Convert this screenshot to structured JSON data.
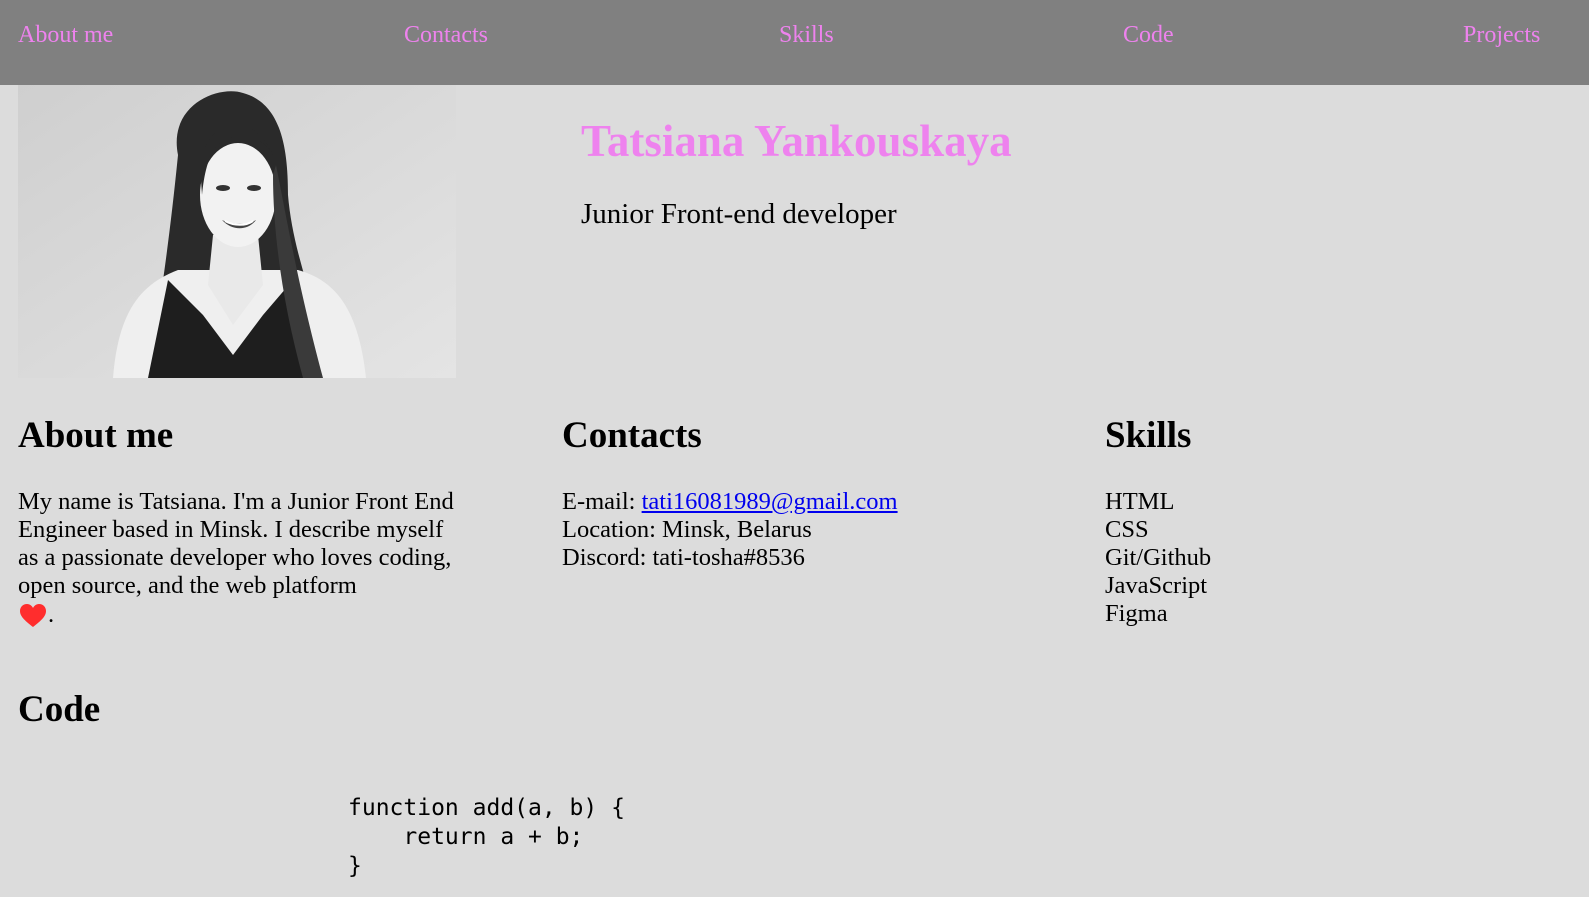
{
  "nav": {
    "items": [
      {
        "label": "About me"
      },
      {
        "label": "Contacts"
      },
      {
        "label": "Skills"
      },
      {
        "label": "Code"
      },
      {
        "label": "Projects"
      }
    ]
  },
  "colors": {
    "nav_background": "#808080",
    "accent": "#ee82ee",
    "page_background": "#dcdcdc",
    "link": "#0000ee",
    "heart": "#ff2d2d"
  },
  "header": {
    "name": "Tatsiana Yankouskaya",
    "subtitle": "Junior Front-end developer"
  },
  "about": {
    "heading": "About me",
    "text": "My name is Tatsiana. I'm a Junior Front End Engineer based in Minsk. I describe myself as a passionate developer who loves coding, open source, and the web platform",
    "heart_icon": "heart-icon",
    "end": "."
  },
  "contacts": {
    "heading": "Contacts",
    "email_label": "E-mail: ",
    "email": "tati16081989@gmail.com",
    "location": "Location: Minsk, Belarus",
    "discord": "Discord: tati-tosha#8536"
  },
  "skills": {
    "heading": "Skills",
    "items": [
      "HTML",
      "CSS",
      "Git/Github",
      "JavaScript",
      "Figma"
    ]
  },
  "code": {
    "heading": "Code",
    "snippet": "function add(a, b) {\n    return a + b;\n}"
  }
}
